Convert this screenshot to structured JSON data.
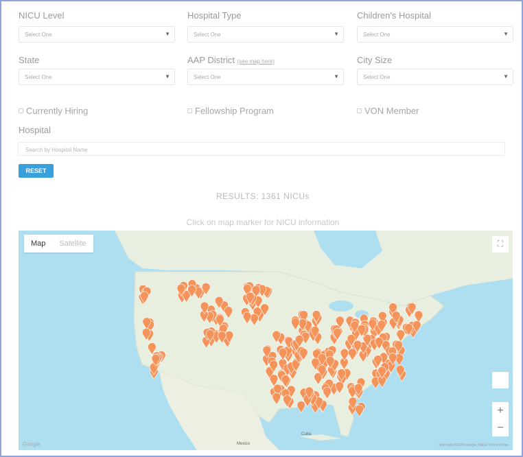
{
  "filters": {
    "nicu_level": {
      "label": "NICU Level",
      "value": "Select One"
    },
    "hospital_type": {
      "label": "Hospital Type",
      "value": "Select One"
    },
    "childrens_hospital": {
      "label": "Children's Hospital",
      "value": "Select One"
    },
    "state": {
      "label": "State",
      "value": "Select One"
    },
    "aap_district": {
      "label": "AAP District",
      "link": "(see map here)",
      "value": "Select One"
    },
    "city_size": {
      "label": "City Size",
      "value": "Select One"
    }
  },
  "checkboxes": {
    "currently_hiring": "Currently Hiring",
    "fellowship_program": "Fellowship Program",
    "von_member": "VON Member"
  },
  "hospital": {
    "label": "Hospital",
    "placeholder": "Search by Hospital Name"
  },
  "reset_label": "RESET",
  "results_text": "RESULTS: 1361 NICUs",
  "hint_text": "Click on map marker for NICU information",
  "map": {
    "tab_map": "Map",
    "tab_satellite": "Satellite",
    "zoom_in": "+",
    "zoom_out": "−",
    "fullscreen_icon": "⛶",
    "google_logo": "Google",
    "attribution": "Map data ©2020 Google, INEGI   Terms of Use",
    "label_mexico": "Mexico",
    "label_cuba": "Cuba"
  },
  "colors": {
    "accent": "#3aa0dc",
    "marker": "#f4935a",
    "water": "#aedff1",
    "land": "#e9efdf"
  }
}
